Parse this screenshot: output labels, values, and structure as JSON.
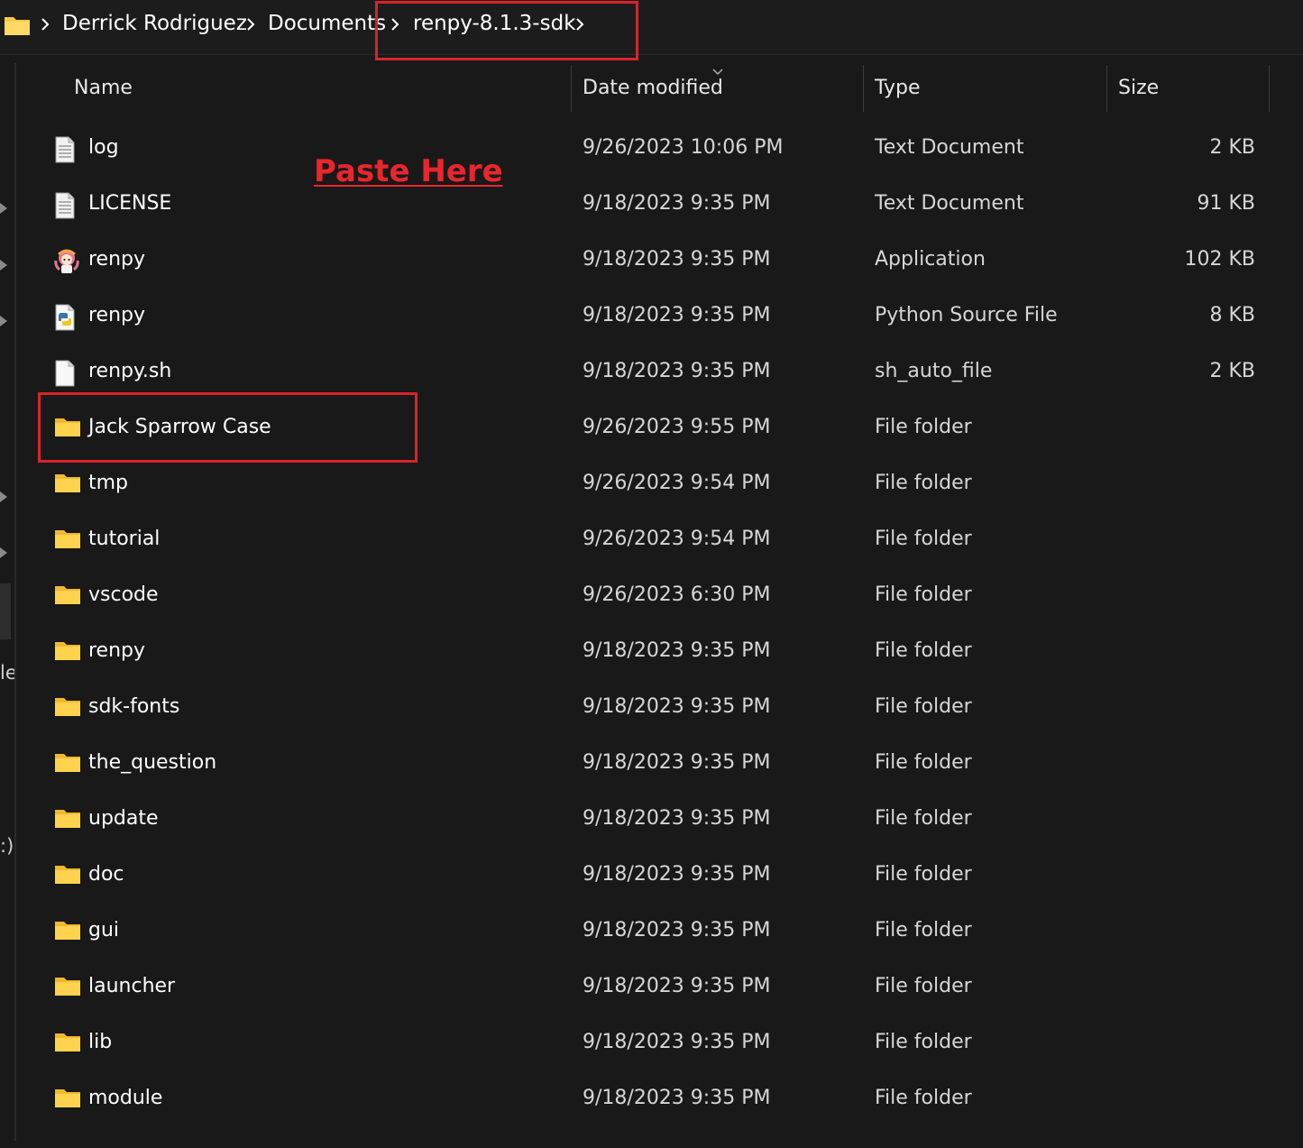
{
  "breadcrumb": {
    "items": [
      {
        "label": "Derrick Rodriguez"
      },
      {
        "label": "Documents"
      },
      {
        "label": "renpy-8.1.3-sdk"
      }
    ]
  },
  "columns": {
    "name": "Name",
    "date_modified": "Date modified",
    "type": "Type",
    "size": "Size"
  },
  "left_pane_fragments": [
    "le",
    ":)"
  ],
  "annotation": {
    "label": "Paste Here",
    "color": "#e8262d"
  },
  "files": [
    {
      "name": "log",
      "date": "9/26/2023 10:06 PM",
      "type": "Text Document",
      "size": "2 KB",
      "icon": "text-document-icon"
    },
    {
      "name": "LICENSE",
      "date": "9/18/2023 9:35 PM",
      "type": "Text Document",
      "size": "91 KB",
      "icon": "text-document-icon"
    },
    {
      "name": "renpy",
      "date": "9/18/2023 9:35 PM",
      "type": "Application",
      "size": "102 KB",
      "icon": "renpy-app-icon"
    },
    {
      "name": "renpy",
      "date": "9/18/2023 9:35 PM",
      "type": "Python Source File",
      "size": "8 KB",
      "icon": "python-file-icon"
    },
    {
      "name": "renpy.sh",
      "date": "9/18/2023 9:35 PM",
      "type": "sh_auto_file",
      "size": "2 KB",
      "icon": "blank-file-icon"
    },
    {
      "name": "Jack Sparrow Case",
      "date": "9/26/2023 9:55 PM",
      "type": "File folder",
      "size": "",
      "icon": "folder-icon"
    },
    {
      "name": "tmp",
      "date": "9/26/2023 9:54 PM",
      "type": "File folder",
      "size": "",
      "icon": "folder-icon"
    },
    {
      "name": "tutorial",
      "date": "9/26/2023 9:54 PM",
      "type": "File folder",
      "size": "",
      "icon": "folder-icon"
    },
    {
      "name": "vscode",
      "date": "9/26/2023 6:30 PM",
      "type": "File folder",
      "size": "",
      "icon": "folder-icon"
    },
    {
      "name": "renpy",
      "date": "9/18/2023 9:35 PM",
      "type": "File folder",
      "size": "",
      "icon": "folder-icon"
    },
    {
      "name": "sdk-fonts",
      "date": "9/18/2023 9:35 PM",
      "type": "File folder",
      "size": "",
      "icon": "folder-icon"
    },
    {
      "name": "the_question",
      "date": "9/18/2023 9:35 PM",
      "type": "File folder",
      "size": "",
      "icon": "folder-icon"
    },
    {
      "name": "update",
      "date": "9/18/2023 9:35 PM",
      "type": "File folder",
      "size": "",
      "icon": "folder-icon"
    },
    {
      "name": "doc",
      "date": "9/18/2023 9:35 PM",
      "type": "File folder",
      "size": "",
      "icon": "folder-icon"
    },
    {
      "name": "gui",
      "date": "9/18/2023 9:35 PM",
      "type": "File folder",
      "size": "",
      "icon": "folder-icon"
    },
    {
      "name": "launcher",
      "date": "9/18/2023 9:35 PM",
      "type": "File folder",
      "size": "",
      "icon": "folder-icon"
    },
    {
      "name": "lib",
      "date": "9/18/2023 9:35 PM",
      "type": "File folder",
      "size": "",
      "icon": "folder-icon"
    },
    {
      "name": "module",
      "date": "9/18/2023 9:35 PM",
      "type": "File folder",
      "size": "",
      "icon": "folder-icon"
    }
  ],
  "colors": {
    "background": "#191919",
    "folder": "#f7c948",
    "highlight": "#d9232a"
  }
}
